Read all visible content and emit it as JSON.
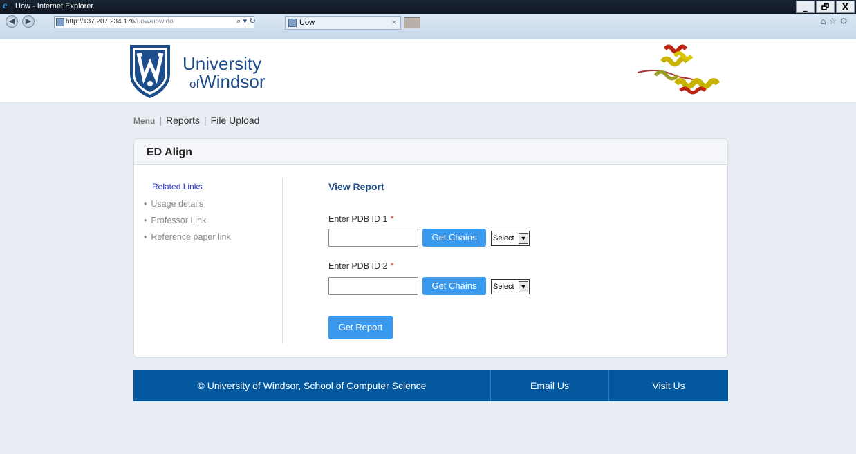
{
  "window": {
    "title": "Uow - Internet Explorer",
    "minimize_label": "_",
    "restore_label": "🗗",
    "close_label": "X"
  },
  "browser": {
    "url_host": "http://137.207.234.176",
    "url_path": "/uow/uow.do",
    "tab_title": "Uow",
    "tab_close": "×",
    "back_icon": "back-arrow-icon",
    "forward_icon": "forward-arrow-icon",
    "tools_glyphs": "⌕ ▾  ↻",
    "right_glyphs": "⌂☆⚙"
  },
  "brand": {
    "line1": "University",
    "of": "of",
    "line2": "Windsor",
    "color": "#1e4d8c"
  },
  "menu": {
    "label": "Menu",
    "sep1": "|",
    "reports": "Reports",
    "sep2": "|",
    "file_upload": "File Upload"
  },
  "panel": {
    "title": "ED Align",
    "related_links": "Related Links",
    "links": [
      {
        "bullet": "•",
        "label": "Usage details"
      },
      {
        "bullet": "•",
        "label": "Professor Link"
      },
      {
        "bullet": "•",
        "label": "Reference paper link"
      }
    ],
    "report_title": "View Report",
    "pdb1_label": "Enter PDB ID 1",
    "pdb2_label": "Enter PDB ID 2",
    "required": "*",
    "pdb1_value": "",
    "pdb2_value": "",
    "get_chains": "Get Chains",
    "select_value": "Select",
    "get_report": "Get Report"
  },
  "footer": {
    "copyright": "© University of Windsor, School of Computer Science",
    "email": "Email Us",
    "visit": "Visit Us",
    "bg_color": "#04589e"
  },
  "colors": {
    "accent_button": "#3a9af0",
    "required": "#d43030",
    "link": "#2130c8"
  }
}
